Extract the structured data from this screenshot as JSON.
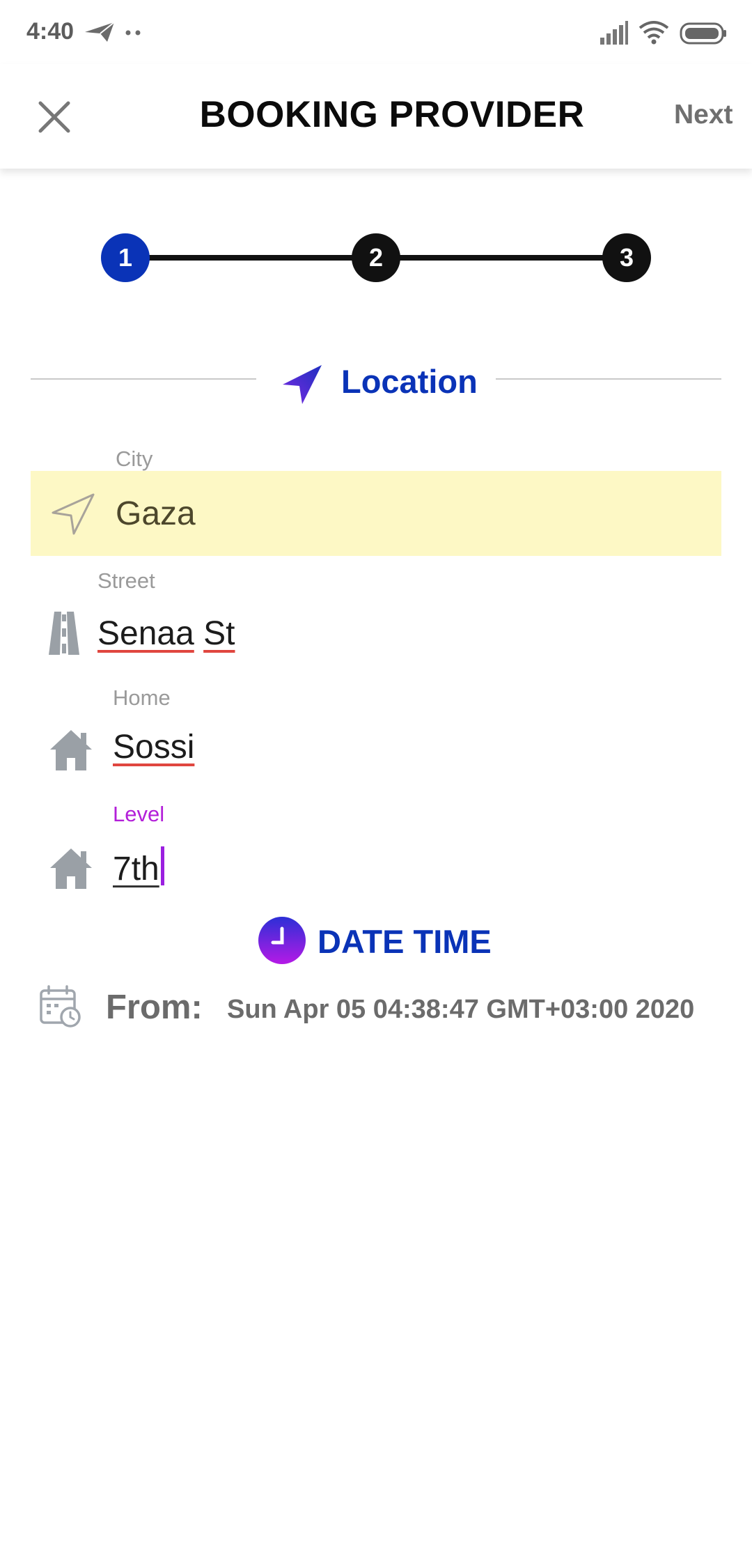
{
  "status_bar": {
    "time": "4:40",
    "icons": [
      "send-icon",
      "more-dots-icon",
      "signal-icon",
      "wifi-icon",
      "battery-icon"
    ]
  },
  "appbar": {
    "title": "BOOKING PROVIDER",
    "next_label": "Next",
    "close_icon": "close-icon"
  },
  "stepper": {
    "steps": [
      "1",
      "2",
      "3"
    ],
    "active_index": 0,
    "active_color": "#0a33b7",
    "inactive_color": "#111111"
  },
  "location_section": {
    "title": "Location",
    "icon": "navigation-arrow-icon",
    "fields": {
      "city": {
        "label": "City",
        "value": "Gaza",
        "icon": "navigation-outline-icon",
        "highlight_color": "#fdf8c5"
      },
      "street": {
        "label": "Street",
        "value_words": [
          "Senaa",
          "St"
        ],
        "icon": "road-icon"
      },
      "home": {
        "label": "Home",
        "value": "Sossi",
        "icon": "house-icon"
      },
      "level": {
        "label": "Level",
        "value": "7th",
        "icon": "house-icon",
        "focused_color": "#b31fd9"
      }
    }
  },
  "datetime_section": {
    "title": "DATE TIME",
    "icon": "clock-icon",
    "from_label": "From:",
    "from_value": "Sun Apr 05 04:38:47 GMT+03:00 2020",
    "from_icon": "calendar-clock-icon"
  },
  "colors": {
    "accent_blue": "#0a33b7",
    "focus_purple": "#b31fd9",
    "spell_underline": "#e0463f"
  }
}
